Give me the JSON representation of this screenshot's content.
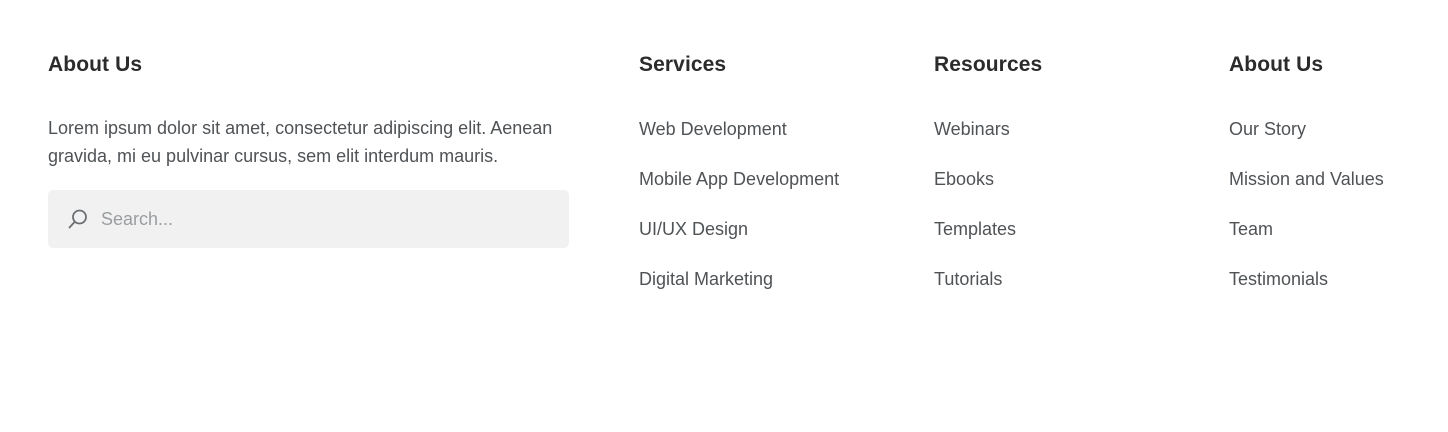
{
  "about": {
    "heading": "About Us",
    "description": "Lorem ipsum dolor sit amet, consectetur adipiscing elit. Aenean gravida, mi eu pulvinar cursus, sem elit interdum mauris.",
    "search": {
      "placeholder": "Search...",
      "icon": "search-icon"
    }
  },
  "services": {
    "heading": "Services",
    "links": [
      "Web Development",
      "Mobile App Development",
      "UI/UX Design",
      "Digital Marketing"
    ]
  },
  "resources": {
    "heading": "Resources",
    "links": [
      "Webinars",
      "Ebooks",
      "Templates",
      "Tutorials"
    ]
  },
  "about_links": {
    "heading": "About Us",
    "links": [
      "Our Story",
      "Mission and Values",
      "Team",
      "Testimonials"
    ]
  },
  "colors": {
    "heading": "#2b2b2b",
    "text": "#4f5356",
    "search_bg": "#f1f1f1",
    "placeholder": "#9a9da0"
  }
}
